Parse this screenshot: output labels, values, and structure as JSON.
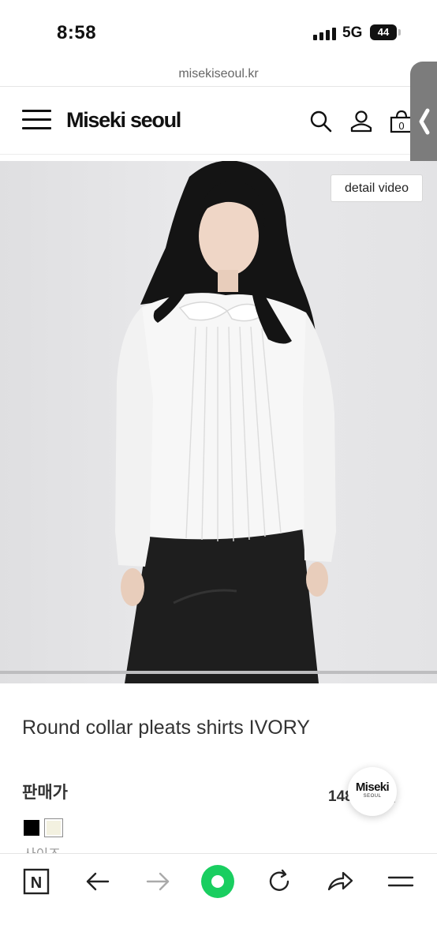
{
  "status_bar": {
    "time": "8:58",
    "network": "5G",
    "battery": "44",
    "signal_bars": 4
  },
  "browser": {
    "url": "misekiseoul.kr"
  },
  "header": {
    "menu_icon": "hamburger-icon",
    "brand": "Miseki seoul",
    "search_icon": "search-icon",
    "account_icon": "user-icon",
    "cart_icon": "cart-icon",
    "cart_count": "0",
    "side_tab_icon": "chevron-left-icon"
  },
  "product": {
    "video_button_label": "detail video",
    "title": "Round collar pleats shirts IVORY",
    "price_label": "판매가",
    "price_value": "148,000원",
    "colors": [
      {
        "name": "black",
        "hex": "#000000"
      },
      {
        "name": "ivory",
        "hex": "#f3f1e0"
      }
    ]
  },
  "floating_badge": {
    "main": "Miseki",
    "sub": "SEOUL"
  },
  "bottom_nav": {
    "items": [
      {
        "name": "naver-home-icon",
        "glyph": "N"
      },
      {
        "name": "back-arrow-icon"
      },
      {
        "name": "forward-arrow-icon"
      },
      {
        "name": "green-dot-icon"
      },
      {
        "name": "reload-icon"
      },
      {
        "name": "share-icon"
      },
      {
        "name": "menu-icon"
      }
    ]
  },
  "colors": {
    "green_dot": "#19ce60",
    "side_tab": "#7c7c7c"
  }
}
